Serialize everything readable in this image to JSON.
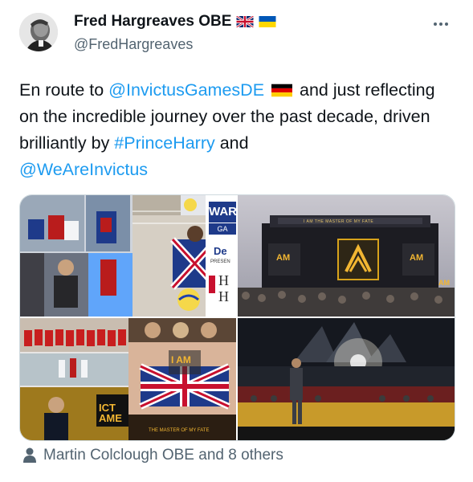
{
  "tweet": {
    "display_name": "Fred Hargreaves OBE",
    "handle": "@FredHargreaves",
    "text_parts": [
      {
        "t": "En route to ",
        "link": false
      },
      {
        "t": "@InvictusGamesDE",
        "link": true
      },
      {
        "t": " 🇩🇪 ",
        "link": false,
        "flag": "de"
      },
      {
        "t": "and just reflecting on the incredible journey over the past decade, driven brilliantly by ",
        "link": false
      },
      {
        "t": "#PrinceHarry",
        "link": true
      },
      {
        "t": " and ",
        "link": false
      },
      {
        "t": "@WeAreInvictus",
        "link": true
      }
    ],
    "footer_text": "Martin Colclough OBE and 8 others",
    "flags": [
      "uk-flag",
      "ukraine-flag"
    ]
  },
  "media": {
    "banner_text": "WAR",
    "banner_sub": "GA",
    "letter_de": "De",
    "letter_present": "PRESEN",
    "letter_h1": "H",
    "letter_h2": "H",
    "concert_banner": "I AM THE MASTER OF MY FATE",
    "am_left": "AM",
    "am_right": "AM",
    "am_edge": "AM",
    "am_main": "I AM",
    "ict": "ICT",
    "ame": "AME",
    "bottom_caption": "THE MASTER OF MY FATE"
  },
  "colors": {
    "link": "#1d9bf0",
    "secondary_text": "#536471",
    "border": "#cfd9de"
  }
}
